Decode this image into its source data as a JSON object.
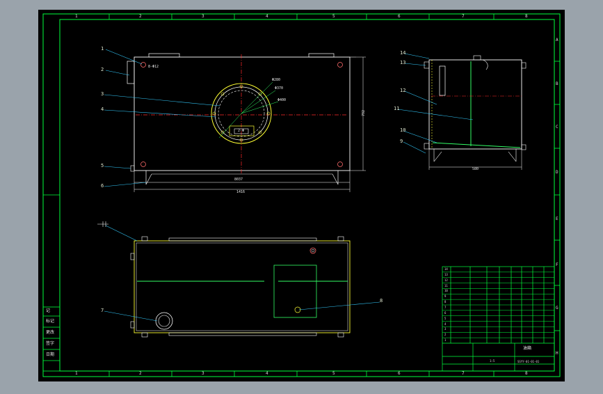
{
  "sheet": {
    "background": "#9aa3ab",
    "paper": "#000000",
    "border_color": "#00ff3c",
    "line_color": "#ffffff",
    "center_line_color": "#ff2a2a",
    "leader_color": "#33ccff",
    "zones_top": [
      "1",
      "2",
      "3",
      "4",
      "5",
      "6",
      "7",
      "8"
    ],
    "zones_side": [
      "A",
      "B",
      "C",
      "D",
      "E",
      "F",
      "G",
      "H"
    ]
  },
  "callouts": {
    "front": [
      "1",
      "2",
      "3",
      "4",
      "5",
      "6"
    ],
    "side": [
      "14",
      "13",
      "12",
      "11",
      "10",
      "9"
    ],
    "top": [
      "7",
      "8"
    ]
  },
  "dimensions": {
    "front_inner": "8037",
    "front_overall": "1416",
    "front_height": "792",
    "side_width": "580",
    "flange_d1": "Φ280",
    "flange_d2": "Φ370",
    "flange_d3": "Φ400",
    "hole_note": "8-Φ12",
    "port_note": "2-Φ"
  },
  "left_block": [
    "记",
    "标记",
    "更改",
    "签字",
    "日期"
  ],
  "title_block": {
    "rows": [
      "14",
      "13",
      "12",
      "11",
      "10",
      "9",
      "8",
      "7",
      "6",
      "5",
      "4",
      "3",
      "2",
      "1"
    ],
    "name": "油箱",
    "drawing_no": "SSYY-01-01-01",
    "scale": "1:5"
  }
}
